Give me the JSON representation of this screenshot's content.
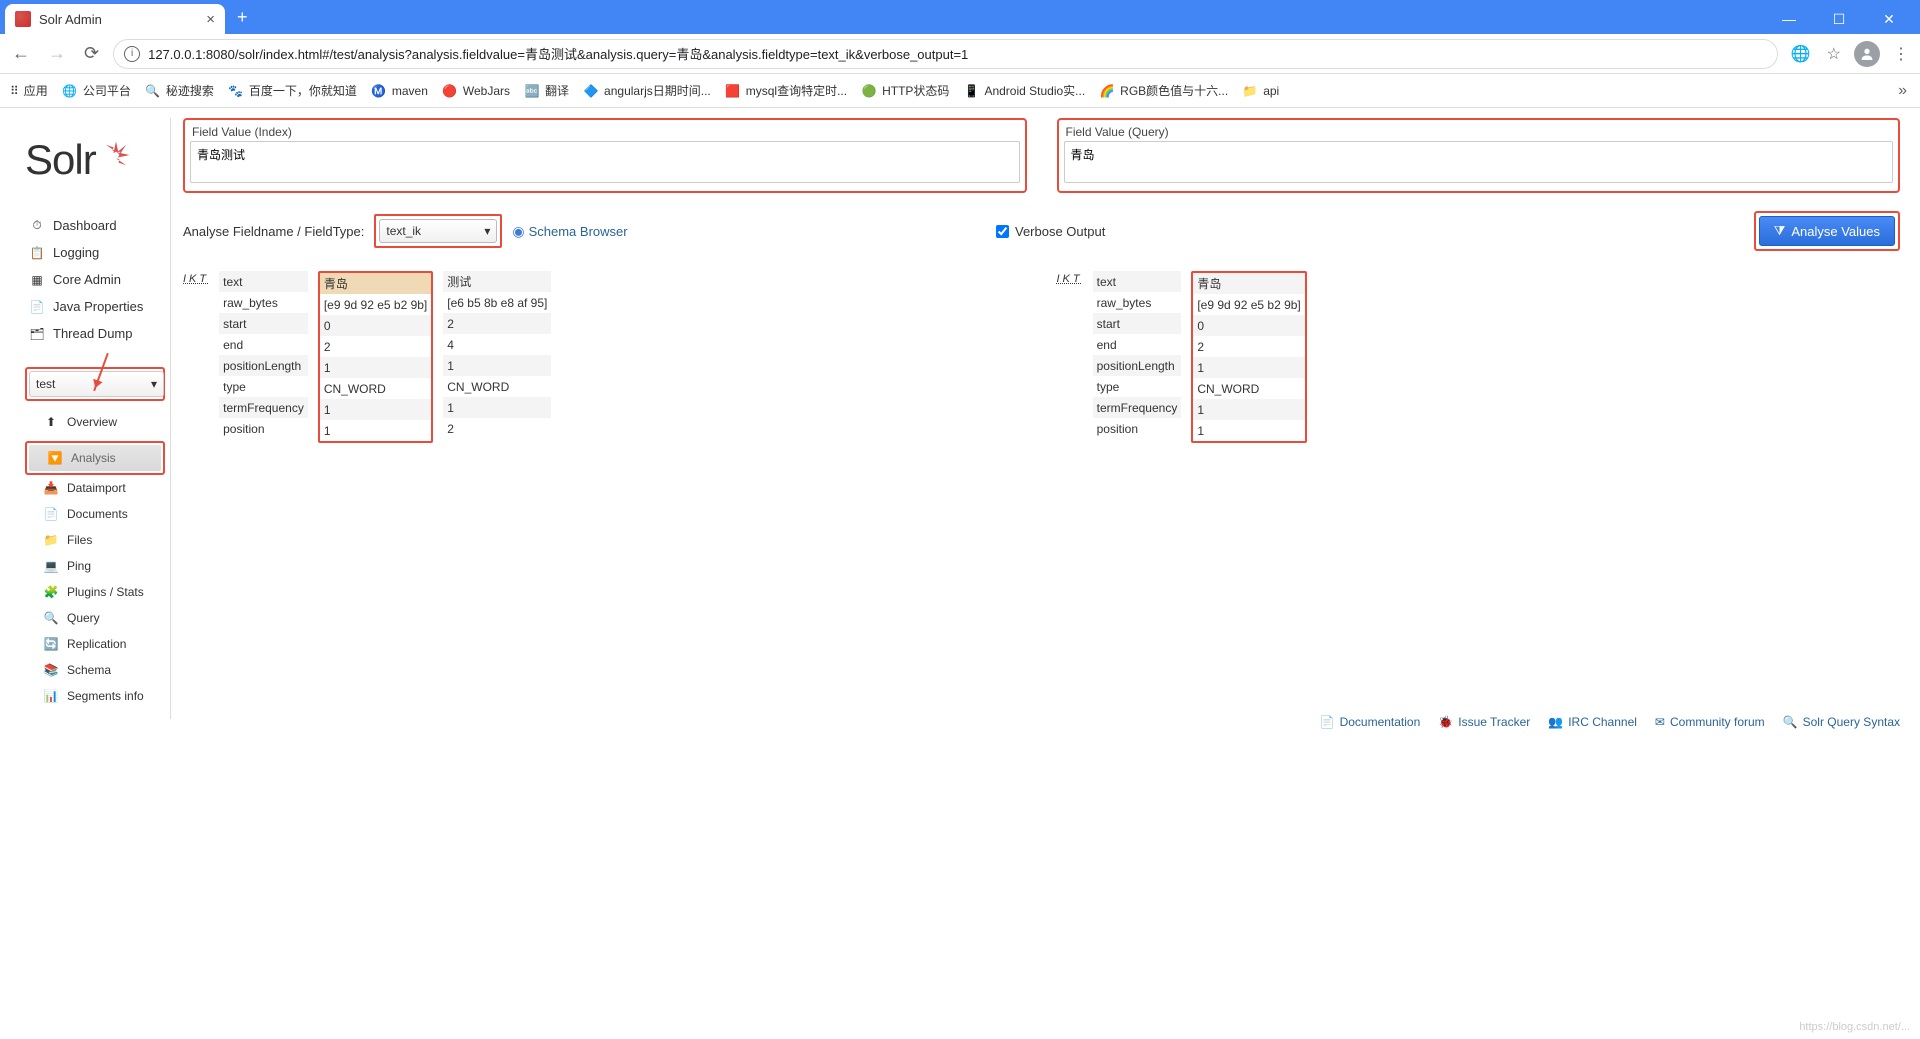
{
  "browser": {
    "tab_title": "Solr Admin",
    "url": "127.0.0.1:8080/solr/index.html#/test/analysis?analysis.fieldvalue=青岛测试&analysis.query=青岛&analysis.fieldtype=text_ik&verbose_output=1",
    "bookmarks_label": "应用",
    "bookmarks": [
      {
        "icon": "🌐",
        "label": "公司平台"
      },
      {
        "icon": "🔍",
        "label": "秘迹搜索"
      },
      {
        "icon": "🐾",
        "label": "百度一下，你就知道"
      },
      {
        "icon": "Ⓜ️",
        "label": "maven"
      },
      {
        "icon": "🔴",
        "label": "WebJars"
      },
      {
        "icon": "🔤",
        "label": "翻译"
      },
      {
        "icon": "🔷",
        "label": "angularjs日期时间..."
      },
      {
        "icon": "🟥",
        "label": "mysql查询特定时..."
      },
      {
        "icon": "🟢",
        "label": "HTTP状态码"
      },
      {
        "icon": "📱",
        "label": "Android Studio实..."
      },
      {
        "icon": "🌈",
        "label": "RGB颜色值与十六..."
      },
      {
        "icon": "📁",
        "label": "api"
      }
    ]
  },
  "sidebar": {
    "main_nav": [
      {
        "icon": "⏱",
        "label": "Dashboard"
      },
      {
        "icon": "📋",
        "label": "Logging"
      },
      {
        "icon": "▦",
        "label": "Core Admin"
      },
      {
        "icon": "📄",
        "label": "Java Properties"
      },
      {
        "icon": "🗂",
        "label": "Thread Dump"
      }
    ],
    "core_selected": "test",
    "sub_nav": [
      {
        "icon": "⬆",
        "label": "Overview",
        "active": false
      },
      {
        "icon": "🔽",
        "label": "Analysis",
        "active": true
      },
      {
        "icon": "📥",
        "label": "Dataimport",
        "active": false
      },
      {
        "icon": "📄",
        "label": "Documents",
        "active": false
      },
      {
        "icon": "📁",
        "label": "Files",
        "active": false
      },
      {
        "icon": "💻",
        "label": "Ping",
        "active": false
      },
      {
        "icon": "🧩",
        "label": "Plugins / Stats",
        "active": false
      },
      {
        "icon": "🔍",
        "label": "Query",
        "active": false
      },
      {
        "icon": "🔄",
        "label": "Replication",
        "active": false
      },
      {
        "icon": "📚",
        "label": "Schema",
        "active": false
      },
      {
        "icon": "📊",
        "label": "Segments info",
        "active": false
      }
    ]
  },
  "analysis": {
    "index_label": "Field Value (Index)",
    "index_value": "青岛测试",
    "query_label": "Field Value (Query)",
    "query_value": "青岛",
    "fieldtype_label": "Analyse Fieldname / FieldType:",
    "fieldtype_value": "text_ik",
    "schema_browser": "Schema Browser",
    "verbose_label": "Verbose Output",
    "analyse_button": "Analyse Values",
    "tokenizer_label": "IKT",
    "row_labels": [
      "text",
      "raw_bytes",
      "start",
      "end",
      "positionLength",
      "type",
      "termFrequency",
      "position"
    ],
    "index_results": [
      {
        "text": "青岛",
        "raw_bytes": "[e9 9d 92 e5 b2 9b]",
        "start": "0",
        "end": "2",
        "positionLength": "1",
        "type": "CN_WORD",
        "termFrequency": "1",
        "position": "1",
        "match": true
      },
      {
        "text": "测试",
        "raw_bytes": "[e6 b5 8b e8 af 95]",
        "start": "2",
        "end": "4",
        "positionLength": "1",
        "type": "CN_WORD",
        "termFrequency": "1",
        "position": "2",
        "match": false
      }
    ],
    "query_results": [
      {
        "text": "青岛",
        "raw_bytes": "[e9 9d 92 e5 b2 9b]",
        "start": "0",
        "end": "2",
        "positionLength": "1",
        "type": "CN_WORD",
        "termFrequency": "1",
        "position": "1"
      }
    ]
  },
  "footer": [
    {
      "icon": "📄",
      "label": "Documentation"
    },
    {
      "icon": "🐞",
      "label": "Issue Tracker"
    },
    {
      "icon": "👥",
      "label": "IRC Channel"
    },
    {
      "icon": "✉",
      "label": "Community forum"
    },
    {
      "icon": "🔍",
      "label": "Solr Query Syntax"
    }
  ],
  "watermark": "https://blog.csdn.net/..."
}
